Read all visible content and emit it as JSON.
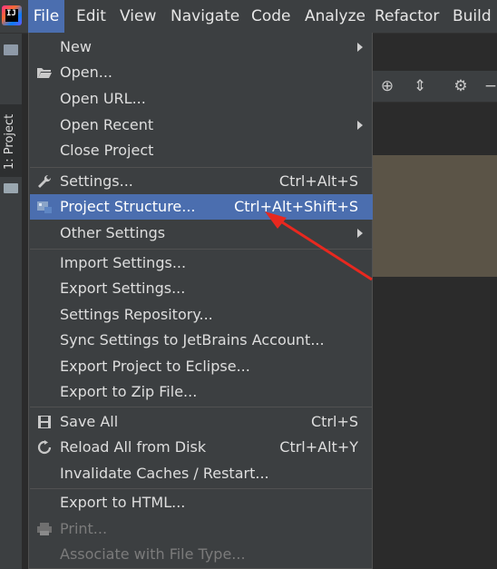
{
  "app": {
    "logo_text": "IJ"
  },
  "menubar": {
    "items": [
      "File",
      "Edit",
      "View",
      "Navigate",
      "Code",
      "Analyze",
      "Refactor",
      "Build"
    ]
  },
  "sidebar": {
    "project_tab": "1: Project"
  },
  "file_menu": {
    "items": [
      {
        "label": "New",
        "shortcut": "",
        "submenu": true,
        "icon": ""
      },
      {
        "label": "Open...",
        "shortcut": "",
        "submenu": false,
        "icon": "folder-open-icon"
      },
      {
        "label": "Open URL...",
        "shortcut": "",
        "submenu": false,
        "icon": ""
      },
      {
        "label": "Open Recent",
        "shortcut": "",
        "submenu": true,
        "icon": ""
      },
      {
        "label": "Close Project",
        "shortcut": "",
        "submenu": false,
        "icon": ""
      },
      {
        "label": "Settings...",
        "shortcut": "Ctrl+Alt+S",
        "submenu": false,
        "icon": "wrench-icon"
      },
      {
        "label": "Project Structure...",
        "shortcut": "Ctrl+Alt+Shift+S",
        "submenu": false,
        "icon": "project-structure-icon",
        "selected": true
      },
      {
        "label": "Other Settings",
        "shortcut": "",
        "submenu": true,
        "icon": ""
      },
      {
        "label": "Import Settings...",
        "shortcut": "",
        "submenu": false,
        "icon": ""
      },
      {
        "label": "Export Settings...",
        "shortcut": "",
        "submenu": false,
        "icon": ""
      },
      {
        "label": "Settings Repository...",
        "shortcut": "",
        "submenu": false,
        "icon": ""
      },
      {
        "label": "Sync Settings to JetBrains Account...",
        "shortcut": "",
        "submenu": false,
        "icon": ""
      },
      {
        "label": "Export Project to Eclipse...",
        "shortcut": "",
        "submenu": false,
        "icon": ""
      },
      {
        "label": "Export to Zip File...",
        "shortcut": "",
        "submenu": false,
        "icon": ""
      },
      {
        "label": "Save All",
        "shortcut": "Ctrl+S",
        "submenu": false,
        "icon": "save-icon"
      },
      {
        "label": "Reload All from Disk",
        "shortcut": "Ctrl+Alt+Y",
        "submenu": false,
        "icon": "reload-icon"
      },
      {
        "label": "Invalidate Caches / Restart...",
        "shortcut": "",
        "submenu": false,
        "icon": ""
      },
      {
        "label": "Export to HTML...",
        "shortcut": "",
        "submenu": false,
        "icon": ""
      },
      {
        "label": "Print...",
        "shortcut": "",
        "submenu": false,
        "icon": "print-icon",
        "disabled": true
      },
      {
        "label": "Associate with File Type...",
        "shortcut": "",
        "submenu": false,
        "icon": "",
        "disabled": true
      }
    ]
  },
  "colors": {
    "menu_bg": "#3c3f41",
    "selection": "#4b6eaf",
    "text": "#dedede",
    "disabled_text": "#7b7b7b",
    "annotation_arrow": "#e8281f"
  }
}
